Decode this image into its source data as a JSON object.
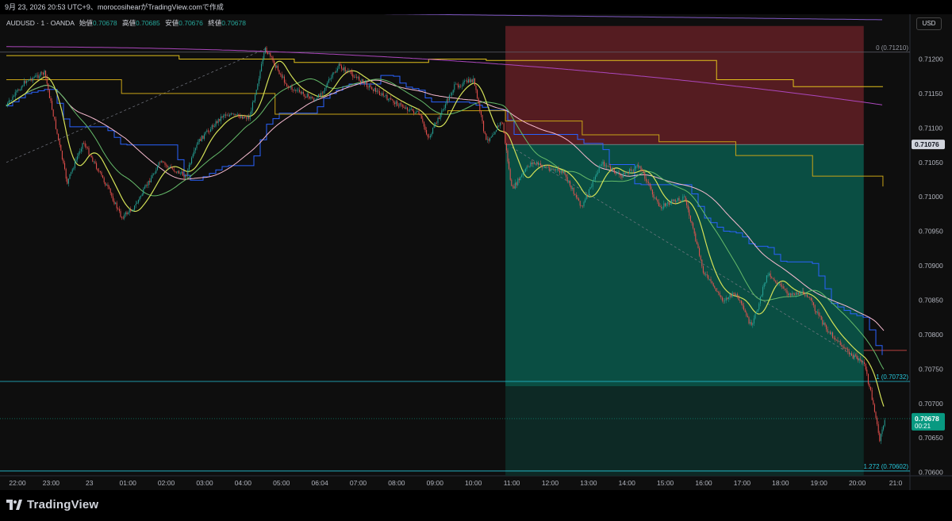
{
  "header": {
    "caption": "9月 23, 2026 20:53 UTC+9、moroсosihearがTradingView.comで作成"
  },
  "legend": {
    "symbol": "AUDUSD · 1 · OANDA",
    "open_label": "始値",
    "open": "0.70678",
    "high_label": "高値",
    "high": "0.70685",
    "low_label": "安値",
    "low": "0.70676",
    "close_label": "終値",
    "close": "0.70678"
  },
  "currency_button": "USD",
  "footer": {
    "brand": "TradingView"
  },
  "chart_data": {
    "type": "line",
    "symbol": "AUDUSD",
    "timeframe": "1",
    "y_range": [
      0.70595,
      0.71265
    ],
    "y_ticks": [
      "0.71200",
      "0.71150",
      "0.71100",
      "0.71050",
      "0.71000",
      "0.70950",
      "0.70900",
      "0.70850",
      "0.70800",
      "0.70750",
      "0.70700",
      "0.70650",
      "0.70600"
    ],
    "x_ticks": [
      "22:00",
      "23:00",
      "23",
      "01:00",
      "02:00",
      "03:00",
      "04:00",
      "05:00",
      "06:04",
      "07:00",
      "08:00",
      "09:00",
      "10:00",
      "11:00",
      "12:00",
      "13:00",
      "14:00",
      "15:00",
      "16:00",
      "17:00",
      "18:00",
      "19:00",
      "20:00",
      "21:0"
    ],
    "price_path": [
      {
        "t": "22:00",
        "price": 0.71132
      },
      {
        "t": "22:30",
        "price": 0.71168
      },
      {
        "t": "23:00",
        "price": 0.7118
      },
      {
        "t": "23:35",
        "price": 0.7102
      },
      {
        "t": "00:00",
        "price": 0.7108
      },
      {
        "t": "00:40",
        "price": 0.7101
      },
      {
        "t": "01:00",
        "price": 0.7097
      },
      {
        "t": "01:20",
        "price": 0.70985
      },
      {
        "t": "02:00",
        "price": 0.7105
      },
      {
        "t": "02:40",
        "price": 0.7103
      },
      {
        "t": "03:00",
        "price": 0.7108
      },
      {
        "t": "03:40",
        "price": 0.7112
      },
      {
        "t": "04:20",
        "price": 0.71115
      },
      {
        "t": "04:45",
        "price": 0.71215
      },
      {
        "t": "05:20",
        "price": 0.7116
      },
      {
        "t": "06:04",
        "price": 0.7114
      },
      {
        "t": "06:40",
        "price": 0.7119
      },
      {
        "t": "07:20",
        "price": 0.71165
      },
      {
        "t": "08:00",
        "price": 0.7114
      },
      {
        "t": "08:45",
        "price": 0.7112
      },
      {
        "t": "09:00",
        "price": 0.71085
      },
      {
        "t": "09:40",
        "price": 0.7116
      },
      {
        "t": "10:10",
        "price": 0.7117
      },
      {
        "t": "10:30",
        "price": 0.7108
      },
      {
        "t": "10:55",
        "price": 0.7111
      },
      {
        "t": "11:10",
        "price": 0.7101
      },
      {
        "t": "11:40",
        "price": 0.7105
      },
      {
        "t": "12:30",
        "price": 0.71035
      },
      {
        "t": "13:00",
        "price": 0.70985
      },
      {
        "t": "13:30",
        "price": 0.7105
      },
      {
        "t": "14:00",
        "price": 0.7103
      },
      {
        "t": "14:30",
        "price": 0.71045
      },
      {
        "t": "15:00",
        "price": 0.70985
      },
      {
        "t": "15:40",
        "price": 0.71
      },
      {
        "t": "16:10",
        "price": 0.7089
      },
      {
        "t": "16:40",
        "price": 0.7085
      },
      {
        "t": "17:00",
        "price": 0.7086
      },
      {
        "t": "17:25",
        "price": 0.7081
      },
      {
        "t": "17:50",
        "price": 0.7089
      },
      {
        "t": "18:20",
        "price": 0.7086
      },
      {
        "t": "18:50",
        "price": 0.7086
      },
      {
        "t": "19:20",
        "price": 0.7081
      },
      {
        "t": "20:00",
        "price": 0.7077
      },
      {
        "t": "20:20",
        "price": 0.7076
      },
      {
        "t": "20:35",
        "price": 0.707
      },
      {
        "t": "20:45",
        "price": 0.70645
      },
      {
        "t": "20:53",
        "price": 0.70678
      }
    ],
    "fib_levels": [
      {
        "label": "0 (0.71210)",
        "price": 0.7121
      },
      {
        "label": "1 (0.70732)",
        "price": 0.70732
      },
      {
        "label": "1.272 (0.70602)",
        "price": 0.70602
      }
    ],
    "position": {
      "type": "short",
      "entry": 0.71076,
      "stop": 0.71248,
      "target": 0.70725,
      "start_time": "11:00",
      "end_time": "20:20",
      "stop_color": "#5a1d23",
      "target_color": "#0b5247"
    },
    "price_tags": [
      {
        "text": "0.71076",
        "bg": "#d1d4dc",
        "fg": "#131722"
      },
      {
        "text": "0.70678",
        "sub": "00:21",
        "bg": "#089981",
        "fg": "#ffffff"
      }
    ],
    "colors": {
      "up": "#26a69a",
      "down": "#ef5350",
      "ema_fast": "#d4e157",
      "ema_mid": "#66bb6a",
      "ema_slow": "#f8bbd0",
      "kijun": "#2962ff",
      "daily_ma": "#e1c01c",
      "weekly_ma": "#ab47bc",
      "fib_line": "#26c6da"
    },
    "grid": false
  }
}
